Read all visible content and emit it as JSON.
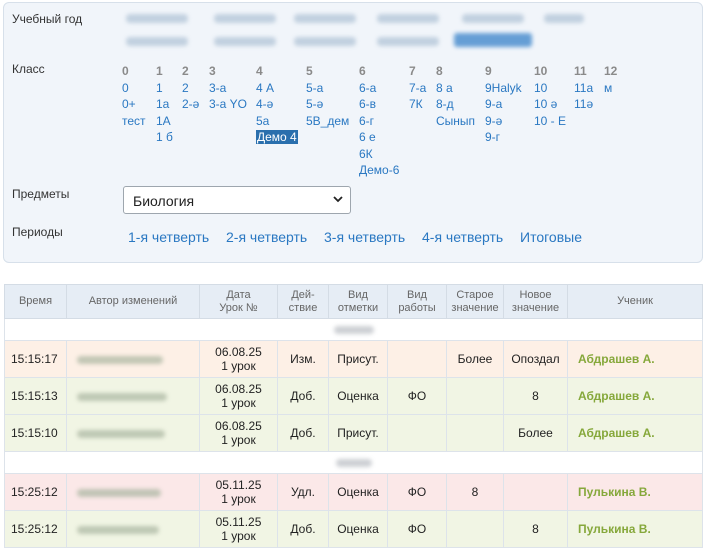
{
  "filters": {
    "year_label": "Учебный год",
    "class_label": "Класс",
    "subjects_label": "Предметы",
    "periods_label": "Периоды",
    "subject_value": "Биология",
    "classes": [
      {
        "head": "0",
        "items": [
          "0",
          "0+",
          "тест"
        ]
      },
      {
        "head": "1",
        "items": [
          "1",
          "1а",
          "1А",
          "1 б"
        ]
      },
      {
        "head": "2",
        "items": [
          "2",
          "2-ә"
        ]
      },
      {
        "head": "3",
        "items": [
          "3-а",
          "3-а YO"
        ]
      },
      {
        "head": "4",
        "items": [
          "4 А",
          "4-ә",
          "5а",
          "Демо 4"
        ]
      },
      {
        "head": "5",
        "items": [
          "5-а",
          "5-ә",
          "5B_дем"
        ]
      },
      {
        "head": "6",
        "items": [
          "6-а",
          "6-в",
          "6-г",
          "6 е",
          "6К",
          "Демо-6"
        ]
      },
      {
        "head": "7",
        "items": [
          "7-а",
          "7К"
        ]
      },
      {
        "head": "8",
        "items": [
          "8 а",
          "8-д",
          "Сынып"
        ]
      },
      {
        "head": "9",
        "items": [
          "9Halyk",
          "9-а",
          "9-ә",
          "9-г"
        ]
      },
      {
        "head": "10",
        "items": [
          "10",
          "10 ә",
          "10 - Е"
        ]
      },
      {
        "head": "11",
        "items": [
          "11а",
          "11ә"
        ]
      },
      {
        "head": "12",
        "items": [
          "м"
        ]
      }
    ],
    "selected_class": "Демо 4",
    "periods": [
      "1-я четверть",
      "2-я четверть",
      "3-я четверть",
      "4-я четверть",
      "Итоговые"
    ]
  },
  "table": {
    "headers": {
      "time": "Время",
      "author": "Автор изменений",
      "date": [
        "Дата",
        "Урок №"
      ],
      "action": [
        "Дей-",
        "ствие"
      ],
      "mark_type": [
        "Вид",
        "отметки"
      ],
      "work_type": [
        "Вид",
        "работы"
      ],
      "old_value": [
        "Старое",
        "значение"
      ],
      "new_value": [
        "Новое",
        "значение"
      ],
      "student": "Ученик"
    },
    "rows": [
      {
        "kind": "sep"
      },
      {
        "kind": "orange",
        "time": "15:15:17",
        "date": "06.08.25",
        "lesson": "1 урок",
        "action": "Изм.",
        "mark_type": "Присут.",
        "work_type": "",
        "old_value": "Более",
        "new_value": "Опоздал",
        "student": "Абдрашев А."
      },
      {
        "kind": "green",
        "time": "15:15:13",
        "date": "06.08.25",
        "lesson": "1 урок",
        "action": "Доб.",
        "mark_type": "Оценка",
        "work_type": "ФО",
        "old_value": "",
        "new_value": "8",
        "student": "Абдрашев А."
      },
      {
        "kind": "green",
        "time": "15:15:10",
        "date": "06.08.25",
        "lesson": "1 урок",
        "action": "Доб.",
        "mark_type": "Присут.",
        "work_type": "",
        "old_value": "",
        "new_value": "Более",
        "student": "Абдрашев А."
      },
      {
        "kind": "sep"
      },
      {
        "kind": "red",
        "time": "15:25:12",
        "date": "05.11.25",
        "lesson": "1 урок",
        "action": "Удл.",
        "mark_type": "Оценка",
        "work_type": "ФО",
        "old_value": "8",
        "new_value": "",
        "student": "Пулькина В."
      },
      {
        "kind": "green",
        "time": "15:25:12",
        "date": "05.11.25",
        "lesson": "1 урок",
        "action": "Доб.",
        "mark_type": "Оценка",
        "work_type": "ФО",
        "old_value": "",
        "new_value": "8",
        "student": "Пулькина В."
      }
    ]
  }
}
